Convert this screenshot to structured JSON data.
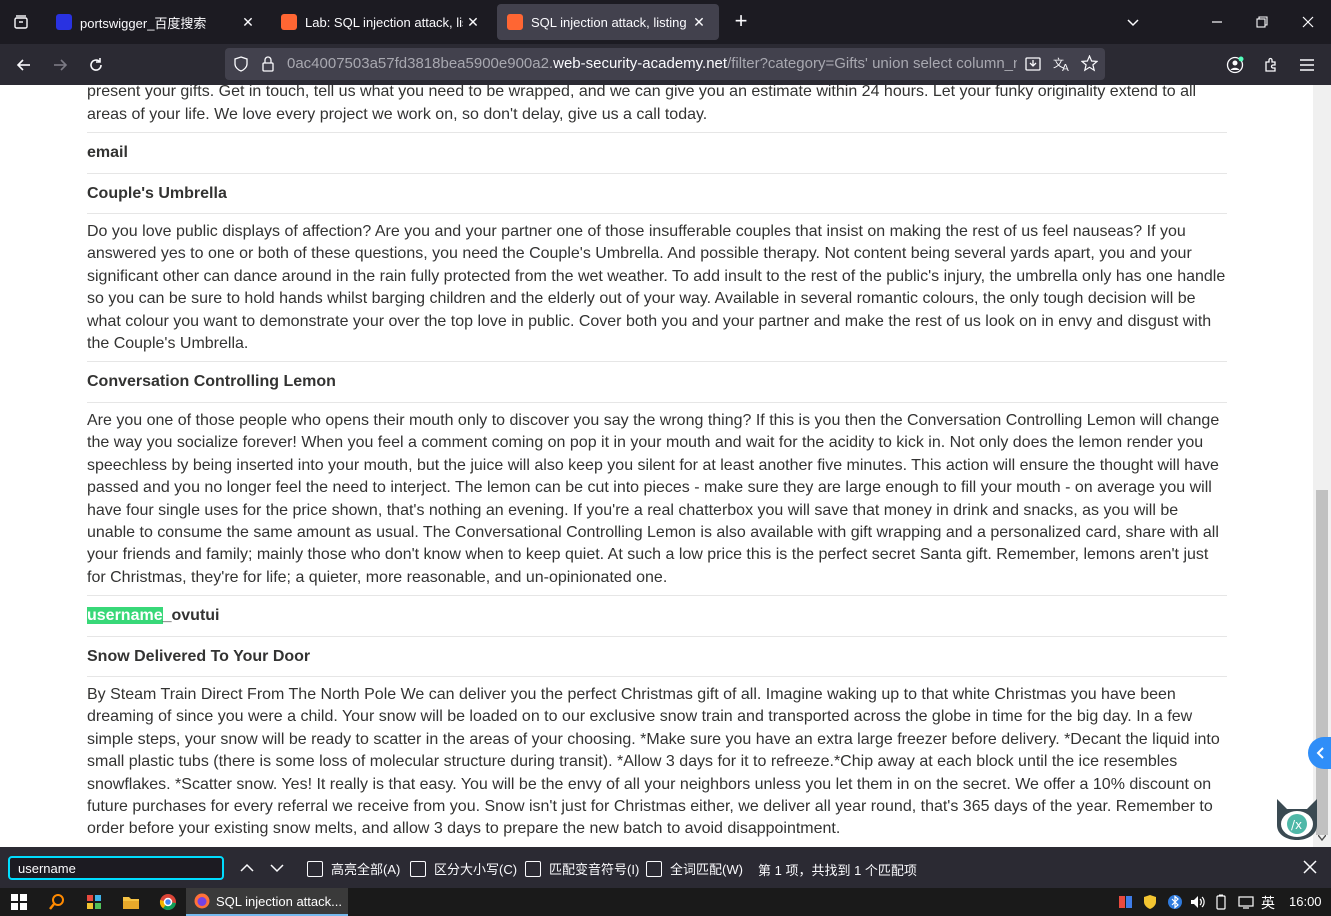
{
  "browser": {
    "tabs": [
      {
        "title": "portswigger_百度搜索",
        "favicon_color": "#2932e1",
        "favicon": "baidu-paw-icon"
      },
      {
        "title": "Lab: SQL injection attack, listi",
        "favicon_color": "#ff6633",
        "favicon": "portswigger-bolt-icon"
      },
      {
        "title": "SQL injection attack, listing tl",
        "favicon_color": "#ff6633",
        "favicon": "portswigger-bolt-icon"
      }
    ],
    "tab_close_glyph": "✕",
    "new_tab_glyph": "+",
    "url_host_prefix": "0ac4007503a57fd3818bea5900e900a2.",
    "url_domain": "web-security-academy.net",
    "url_path": "/filter?category=Gifts' union select column_n"
  },
  "page": {
    "top_text": "to be completed. So, organization is paramount, no leaving shopping until the last minute if you want to take advantage of this fabulously wonderful new way to present your gifts. Get in touch, tell us what you need to be wrapped, and we can give you an estimate within 24 hours. Let your funky originality extend to all areas of your life. We love every project we work on, so don't delay, give us a call today.",
    "rows": [
      {
        "name": "email"
      },
      {
        "name": "Couple's Umbrella",
        "desc": "Do you love public displays of affection? Are you and your partner one of those insufferable couples that insist on making the rest of us feel nauseas? If you answered yes to one or both of these questions, you need the Couple's Umbrella. And possible therapy. Not content being several yards apart, you and your significant other can dance around in the rain fully protected from the wet weather. To add insult to the rest of the public's injury, the umbrella only has one handle so you can be sure to hold hands whilst barging children and the elderly out of your way. Available in several romantic colours, the only tough decision will be what colour you want to demonstrate your over the top love in public. Cover both you and your partner and make the rest of us look on in envy and disgust with the Couple's Umbrella."
      },
      {
        "name": "Conversation Controlling Lemon",
        "desc": "Are you one of those people who opens their mouth only to discover you say the wrong thing? If this is you then the Conversation Controlling Lemon will change the way you socialize forever! When you feel a comment coming on pop it in your mouth and wait for the acidity to kick in. Not only does the lemon render you speechless by being inserted into your mouth, but the juice will also keep you silent for at least another five minutes. This action will ensure the thought will have passed and you no longer feel the need to interject. The lemon can be cut into pieces - make sure they are large enough to fill your mouth - on average you will have four single uses for the price shown, that's nothing an evening. If you're a real chatterbox you will save that money in drink and snacks, as you will be unable to consume the same amount as usual. The Conversational Controlling Lemon is also available with gift wrapping and a personalized card, share with all your friends and family; mainly those who don't know when to keep quiet. At such a low price this is the perfect secret Santa gift. Remember, lemons aren't just for Christmas, they're for life; a quieter, more reasonable, and un-opinionated one."
      },
      {
        "name_highlight": "username",
        "name_rest": "_ovutui"
      },
      {
        "name": "Snow Delivered To Your Door",
        "desc": "By Steam Train Direct From The North Pole We can deliver you the perfect Christmas gift of all. Imagine waking up to that white Christmas you have been dreaming of since you were a child. Your snow will be loaded on to our exclusive snow train and transported across the globe in time for the big day. In a few simple steps, your snow will be ready to scatter in the areas of your choosing. *Make sure you have an extra large freezer before delivery. *Decant the liquid into small plastic tubs (there is some loss of molecular structure during transit). *Allow 3 days for it to refreeze.*Chip away at each block until the ice resembles snowflakes. *Scatter snow. Yes! It really is that easy. You will be the envy of all your neighbors unless you let them in on the secret. We offer a 10% discount on future purchases for every referral we receive from you. Snow isn't just for Christmas either, we deliver all year round, that's 365 days of the year. Remember to order before your existing snow melts, and allow 3 days to prepare the new batch to avoid disappointment."
      }
    ],
    "highlight_color": "#38d878"
  },
  "findbar": {
    "query": "username",
    "options": [
      "高亮全部(A)",
      "区分大小写(C)",
      "匹配变音符号(I)",
      "全词匹配(W)"
    ],
    "status": "第 1 项，共找到 1 个匹配项"
  },
  "taskbar": {
    "app_label": "SQL injection attack...",
    "ime": "英",
    "time": "16:00"
  }
}
